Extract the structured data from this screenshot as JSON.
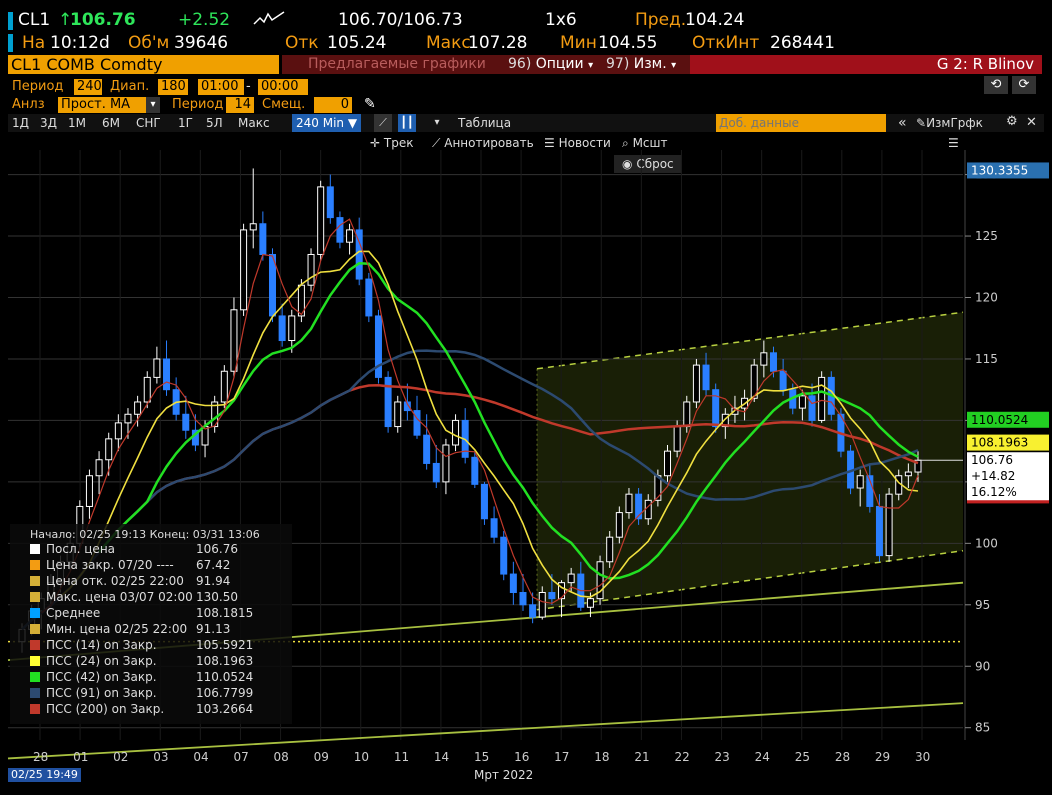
{
  "header": {
    "ticker": "CL1",
    "last": "106.76",
    "change": "+2.52",
    "bid_ask": "106.70/106.73",
    "size": "1x6",
    "prev_label": "Пред.",
    "prev": "104.24",
    "at_label": "На",
    "time": "10:12d",
    "vol_label": "Об'м",
    "volume": "39646",
    "open_label": "Отк",
    "open": "105.24",
    "high_label": "Макс",
    "high": "107.28",
    "low_label": "Мин",
    "low": "104.55",
    "oi_label": "ОткИнт",
    "oi": "268441"
  },
  "toolbar": {
    "security": "CL1 COMB Comdty",
    "suggested": "Предлагаемые графики",
    "options_num": "96)",
    "options": "Опции",
    "edit_num": "97)",
    "edit": "Изм.",
    "user": "G 2: R Blinov"
  },
  "settings": {
    "period_label": "Период",
    "period": "240",
    "range_label": "Диап.",
    "range": "180",
    "time_from": "01:00",
    "time_to": "00:00",
    "analysis_label": "Анлз",
    "analysis": "Прост. MA",
    "period2_label": "Период",
    "period2": "14",
    "shift_label": "Смещ.",
    "shift": "0"
  },
  "ranges": [
    "1Д",
    "3Д",
    "1М",
    "6М",
    "СНГ",
    "1Г",
    "5Л",
    "Макс"
  ],
  "active_range": "240 Min",
  "table_label": "Таблица",
  "add_data_placeholder": "Доб. данные",
  "edit_chart": "ИзмГрфк",
  "tools": {
    "track": "Трек",
    "annotate": "Аннотировать",
    "news": "Новости",
    "zoom": "Мсшт",
    "reset": "Сброс"
  },
  "legend": {
    "header": "Начало: 02/25 19:13 Конец: 03/31 13:06",
    "rows": [
      {
        "label": "Посл. цена",
        "value": "106.76",
        "color": "#ffffff"
      },
      {
        "label": "Цена закр. 07/20 ----",
        "value": "67.42",
        "color": "#f39c12"
      },
      {
        "label": "Цена отк. 02/25 22:00",
        "value": "91.94",
        "color": "#d4af37"
      },
      {
        "label": "Макс. цена 03/07 02:00",
        "value": "130.50",
        "color": "#d4af37"
      },
      {
        "label": "Среднее",
        "value": "108.1815",
        "color": "#00a0ff"
      },
      {
        "label": "Мин. цена 02/25 22:00",
        "value": "91.13",
        "color": "#d4af37"
      },
      {
        "label": "ПСС (14)  on Закр.",
        "value": "105.5921",
        "color": "#c0392b"
      },
      {
        "label": "ПСС (24)  on Закр.",
        "value": "108.1963",
        "color": "#ffff33"
      },
      {
        "label": "ПСС (42)  on Закр.",
        "value": "110.0524",
        "color": "#22e022"
      },
      {
        "label": "ПСС (91)  on Закр.",
        "value": "106.7799",
        "color": "#2c4a70"
      },
      {
        "label": "ПСС (200)  on Закр.",
        "value": "103.2664",
        "color": "#c0392b"
      }
    ]
  },
  "y_ticks": [
    "130",
    "125",
    "120",
    "115",
    "110",
    "105",
    "100",
    "95",
    "90",
    "85"
  ],
  "x_ticks": [
    "28",
    "01",
    "02",
    "03",
    "04",
    "07",
    "08",
    "09",
    "10",
    "11",
    "14",
    "15",
    "16",
    "17",
    "18",
    "21",
    "22",
    "23",
    "24",
    "25",
    "28",
    "29",
    "30"
  ],
  "x_axis_label": "Мрт 2022",
  "bottom_date": "02/25 19:49",
  "price_tags": {
    "top": "130.3355",
    "ma42": "110.0524",
    "ma24": "108.1963",
    "last": "106.76",
    "chg": "+14.82",
    "pct": "16.12%",
    "ma200": "103.2664"
  },
  "colors": {
    "candle_up": "#ffffff",
    "candle_down": "#2a7fff",
    "ma14": "#c0392b",
    "ma24": "#f0e040",
    "ma42": "#22e022",
    "ma91": "#2c4a70",
    "ma200": "#c0392b"
  },
  "chart_data": {
    "type": "line",
    "ylim": [
      84,
      132
    ],
    "candles": [
      [
        92.0,
        93.5,
        91.1,
        93.0
      ],
      [
        93.0,
        95.0,
        92.5,
        94.5
      ],
      [
        94.5,
        96.0,
        93.0,
        95.5
      ],
      [
        95.5,
        97.5,
        94.8,
        96.8
      ],
      [
        96.8,
        99.0,
        96.0,
        98.5
      ],
      [
        98.5,
        100.5,
        97.8,
        100.0
      ],
      [
        100.0,
        103.5,
        99.5,
        103.0
      ],
      [
        103.0,
        106.0,
        102.0,
        105.5
      ],
      [
        105.5,
        107.5,
        104.0,
        106.8
      ],
      [
        106.8,
        109.0,
        105.5,
        108.5
      ],
      [
        108.5,
        110.5,
        107.5,
        109.8
      ],
      [
        109.8,
        111.0,
        108.5,
        110.5
      ],
      [
        110.5,
        112.0,
        109.5,
        111.5
      ],
      [
        111.5,
        114.0,
        111.0,
        113.5
      ],
      [
        113.5,
        116.0,
        113.0,
        115.0
      ],
      [
        115.0,
        116.5,
        112.0,
        112.5
      ],
      [
        112.5,
        113.5,
        110.0,
        110.5
      ],
      [
        110.5,
        112.0,
        108.5,
        109.2
      ],
      [
        109.2,
        110.5,
        107.5,
        108.0
      ],
      [
        108.0,
        110.0,
        107.0,
        109.5
      ],
      [
        109.5,
        112.0,
        109.0,
        111.5
      ],
      [
        111.5,
        114.5,
        111.0,
        114.0
      ],
      [
        114.0,
        120.0,
        113.5,
        119.0
      ],
      [
        119.0,
        126.0,
        118.5,
        125.5
      ],
      [
        125.5,
        130.5,
        124.0,
        126.0
      ],
      [
        126.0,
        127.0,
        123.0,
        123.5
      ],
      [
        123.5,
        124.0,
        118.0,
        118.5
      ],
      [
        118.5,
        119.5,
        116.0,
        116.5
      ],
      [
        116.5,
        119.0,
        115.5,
        118.5
      ],
      [
        118.5,
        121.5,
        118.0,
        121.0
      ],
      [
        121.0,
        124.0,
        120.5,
        123.5
      ],
      [
        123.5,
        129.5,
        123.0,
        129.0
      ],
      [
        129.0,
        130.0,
        126.0,
        126.5
      ],
      [
        126.5,
        127.0,
        124.0,
        124.5
      ],
      [
        124.5,
        126.0,
        123.5,
        125.5
      ],
      [
        125.5,
        126.5,
        121.0,
        121.5
      ],
      [
        121.5,
        122.0,
        118.0,
        118.5
      ],
      [
        118.5,
        119.0,
        113.0,
        113.5
      ],
      [
        113.5,
        114.0,
        109.0,
        109.5
      ],
      [
        109.5,
        112.0,
        109.0,
        111.5
      ],
      [
        111.5,
        113.0,
        110.0,
        110.8
      ],
      [
        110.8,
        112.0,
        108.5,
        108.8
      ],
      [
        108.8,
        110.5,
        106.0,
        106.5
      ],
      [
        106.5,
        108.0,
        104.5,
        105.0
      ],
      [
        105.0,
        108.5,
        104.0,
        108.0
      ],
      [
        108.0,
        110.5,
        107.5,
        110.0
      ],
      [
        110.0,
        111.0,
        106.5,
        107.0
      ],
      [
        107.0,
        107.5,
        104.5,
        104.8
      ],
      [
        104.8,
        105.0,
        101.5,
        102.0
      ],
      [
        102.0,
        103.0,
        100.0,
        100.5
      ],
      [
        100.5,
        101.0,
        97.0,
        97.5
      ],
      [
        97.5,
        98.5,
        95.0,
        96.0
      ],
      [
        96.0,
        97.5,
        94.5,
        95.0
      ],
      [
        95.0,
        96.0,
        93.5,
        94.0
      ],
      [
        94.0,
        96.5,
        93.8,
        96.0
      ],
      [
        96.0,
        97.5,
        95.0,
        95.5
      ],
      [
        95.5,
        97.0,
        94.0,
        96.8
      ],
      [
        96.8,
        98.0,
        96.0,
        97.5
      ],
      [
        97.5,
        98.5,
        94.5,
        94.8
      ],
      [
        94.8,
        96.0,
        94.0,
        95.5
      ],
      [
        95.5,
        99.0,
        95.0,
        98.5
      ],
      [
        98.5,
        101.0,
        98.0,
        100.5
      ],
      [
        100.5,
        103.0,
        100.0,
        102.5
      ],
      [
        102.5,
        104.5,
        102.0,
        104.0
      ],
      [
        104.0,
        104.5,
        101.5,
        102.0
      ],
      [
        102.0,
        104.0,
        101.5,
        103.5
      ],
      [
        103.5,
        106.0,
        103.0,
        105.5
      ],
      [
        105.5,
        108.0,
        105.0,
        107.5
      ],
      [
        107.5,
        110.0,
        107.0,
        109.5
      ],
      [
        109.5,
        112.0,
        109.0,
        111.5
      ],
      [
        111.5,
        115.0,
        111.0,
        114.5
      ],
      [
        114.5,
        115.5,
        112.0,
        112.5
      ],
      [
        112.5,
        113.0,
        109.0,
        109.5
      ],
      [
        109.5,
        111.0,
        108.5,
        110.5
      ],
      [
        110.5,
        112.0,
        109.8,
        111.0
      ],
      [
        111.0,
        112.5,
        110.0,
        111.8
      ],
      [
        111.8,
        115.0,
        111.5,
        114.5
      ],
      [
        114.5,
        116.5,
        113.5,
        115.5
      ],
      [
        115.5,
        116.0,
        113.5,
        114.0
      ],
      [
        114.0,
        115.0,
        112.0,
        112.5
      ],
      [
        112.5,
        113.0,
        110.5,
        111.0
      ],
      [
        111.0,
        112.5,
        110.0,
        112.0
      ],
      [
        112.0,
        113.0,
        109.5,
        110.0
      ],
      [
        110.0,
        114.0,
        109.8,
        113.5
      ],
      [
        113.5,
        114.0,
        110.0,
        110.5
      ],
      [
        110.5,
        111.0,
        107.0,
        107.5
      ],
      [
        107.5,
        108.0,
        104.0,
        104.5
      ],
      [
        104.5,
        106.0,
        103.0,
        105.5
      ],
      [
        105.5,
        106.5,
        102.5,
        103.0
      ],
      [
        103.0,
        104.0,
        98.5,
        99.0
      ],
      [
        99.0,
        104.5,
        98.5,
        104.0
      ],
      [
        104.0,
        106.0,
        103.5,
        105.5
      ],
      [
        105.5,
        106.5,
        104.5,
        105.8
      ],
      [
        105.8,
        107.5,
        105.0,
        106.76
      ]
    ]
  }
}
